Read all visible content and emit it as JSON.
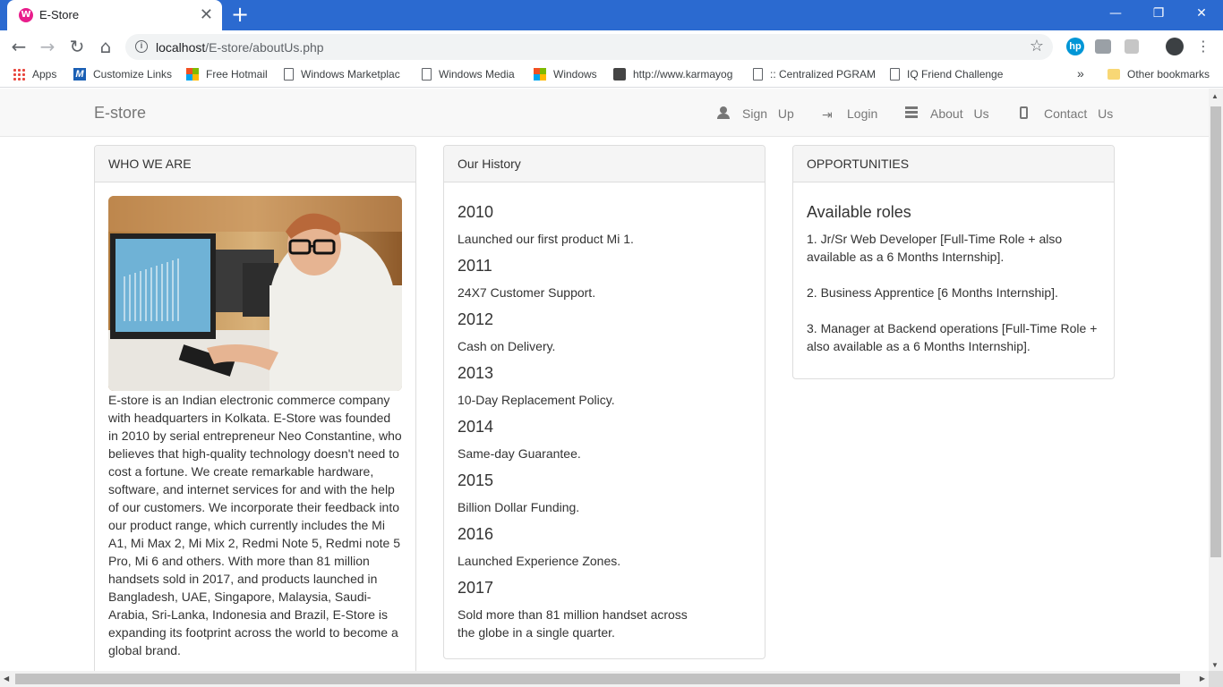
{
  "browser": {
    "tab_title": "E-Store",
    "tab_favicon_letter": "W",
    "url_host": "localhost",
    "url_path": "/E-store/aboutUs.php",
    "window_controls": [
      "—",
      "❐",
      "✕"
    ],
    "bookmarks": [
      {
        "label": "Apps",
        "icon": "apps-grid-icon"
      },
      {
        "label": "Customize Links",
        "icon": "m-logo-icon"
      },
      {
        "label": "Free Hotmail",
        "icon": "windows-logo-icon"
      },
      {
        "label": "Windows Marketplac",
        "icon": "page-icon"
      },
      {
        "label": "Windows Media",
        "icon": "page-icon"
      },
      {
        "label": "Windows",
        "icon": "windows-logo-icon"
      },
      {
        "label": "http://www.karmayog",
        "icon": "site-icon"
      },
      {
        "label": ":: Centralized PGRAM",
        "icon": "page-icon"
      },
      {
        "label": "IQ Friend Challenge",
        "icon": "page-icon"
      }
    ],
    "overflow_chevron": "»",
    "other_bookmarks": "Other bookmarks"
  },
  "navbar": {
    "brand": "E-store",
    "links": [
      {
        "label": "Sign Up",
        "icon": "user-icon"
      },
      {
        "label": "Login",
        "icon": "login-icon"
      },
      {
        "label": "About Us",
        "icon": "list-icon"
      },
      {
        "label": "Contact Us",
        "icon": "phone-icon"
      }
    ]
  },
  "who_we_are": {
    "heading": "WHO WE ARE",
    "text": "E-store is an Indian electronic commerce company with headquarters in Kolkata. E-Store was founded in 2010 by serial entrepreneur Neo Constantine, who believes that high-quality technology doesn't need to cost a fortune. We create remarkable hardware, software, and internet services for and with the help of our customers. We incorporate their feedback into our product range, which currently includes the Mi A1, Mi Max 2, Mi Mix 2, Redmi Note 5, Redmi note 5 Pro, Mi 6 and others. With more than 81 million handsets sold in 2017, and products launched in Bangladesh, UAE, Singapore, Malaysia, Saudi-Arabia, Sri-Lanka, Indonesia and Brazil, E-Store is expanding its footprint across the world to become a global brand."
  },
  "history": {
    "heading": "Our History",
    "entries": [
      {
        "year": "2010",
        "text": "Launched our first product Mi 1."
      },
      {
        "year": "2011",
        "text": "24X7 Customer Support."
      },
      {
        "year": "2012",
        "text": "Cash on Delivery."
      },
      {
        "year": "2013",
        "text": "10-Day Replacement Policy."
      },
      {
        "year": "2014",
        "text": "Same-day Guarantee."
      },
      {
        "year": "2015",
        "text": "Billion Dollar Funding."
      },
      {
        "year": "2016",
        "text": "Launched Experience Zones."
      },
      {
        "year": "2017",
        "text": "Sold more than 81 million handset across the globe in a single quarter."
      }
    ]
  },
  "opportunities": {
    "heading": "OPPORTUNITIES",
    "title": "Available roles",
    "roles": [
      "1. Jr/Sr Web Developer [Full-Time Role + also available as a 6 Months Internship].",
      "2. Business Apprentice [6 Months Internship].",
      "3. Manager at Backend operations [Full-Time Role + also available as a 6 Months Internship]."
    ]
  }
}
